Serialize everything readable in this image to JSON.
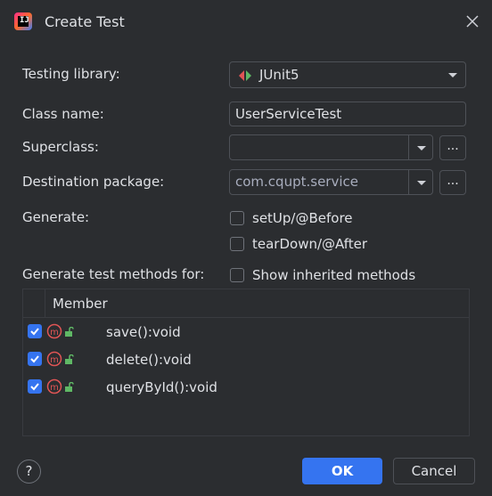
{
  "window": {
    "title": "Create Test"
  },
  "form": {
    "testing_library_label": "Testing library:",
    "testing_library_value": "JUnit5",
    "class_name_label": "Class name:",
    "class_name_value": "UserServiceTest",
    "superclass_label": "Superclass:",
    "superclass_value": "",
    "superclass_browse": "...",
    "destination_label": "Destination package:",
    "destination_value": "com.cqupt.service",
    "destination_browse": "...",
    "generate_label": "Generate:",
    "setup_label": "setUp/@Before",
    "setup_checked": false,
    "teardown_label": "tearDown/@After",
    "teardown_checked": false,
    "methods_label": "Generate test methods for:",
    "show_inherited_label": "Show inherited methods",
    "show_inherited_checked": false
  },
  "table": {
    "header": "Member",
    "rows": [
      {
        "name": "save():void",
        "checked": true
      },
      {
        "name": "delete():void",
        "checked": true
      },
      {
        "name": "queryById():void",
        "checked": true
      }
    ]
  },
  "buttons": {
    "ok": "OK",
    "cancel": "Cancel",
    "help": "?"
  },
  "colors": {
    "accent": "#3574f0",
    "background": "#2b2d30",
    "method_icon": "#e05555",
    "lock_icon": "#5fb865"
  }
}
